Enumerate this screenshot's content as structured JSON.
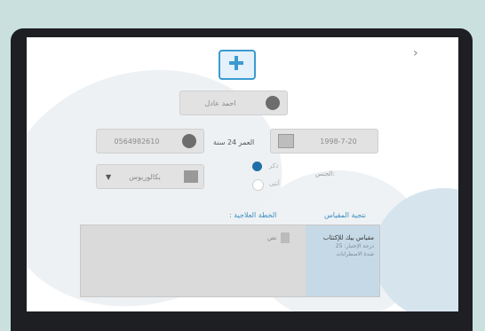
{
  "form": {
    "name_value": "احمد عادل",
    "phone_value": "0564982610",
    "age_label": "العمر 24 سنة",
    "birthdate_value": "1998-7-20",
    "education_value": "بكالوريوس",
    "gender_label": "الجنس:",
    "gender_options": [
      "ذكر",
      "أنثى"
    ],
    "result_heading": "نتجية المقياس",
    "plan_heading": "الخطة العلاجية :",
    "notes_placeholder": "نص",
    "result_lines": [
      "مقياس بيك للإكتئاب",
      "درجة الإختبار: 25",
      "شدة الاضطرابات"
    ]
  },
  "colors": {
    "accent": "#3b8dbd",
    "radio_selected": "#1f70a8",
    "background": "#c9e0de"
  }
}
